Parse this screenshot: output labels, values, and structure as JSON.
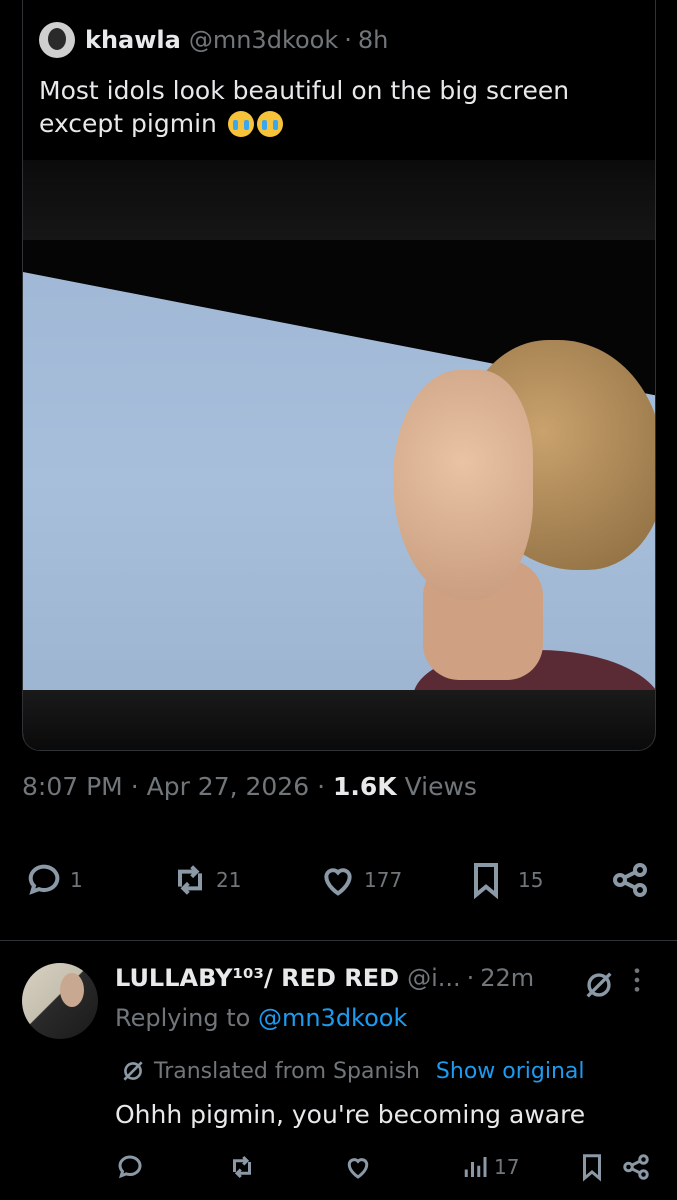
{
  "quoted": {
    "name": "khawla",
    "handle": "@mn3dkook",
    "separator": "·",
    "time": "8h",
    "text": "Most idols look beautiful on the big screen except pigmin",
    "emoji": "loudly-crying-face"
  },
  "meta": {
    "time": "8:07 PM",
    "date": "Apr 27, 2026",
    "views_count": "1.6K",
    "views_label": "Views"
  },
  "actions": {
    "replies": "1",
    "reposts": "21",
    "likes": "177",
    "bookmarks": "15"
  },
  "reply": {
    "name": "LULLABY¹⁰³/ RED RED",
    "handle": "@i...",
    "separator": "·",
    "time": "22m",
    "replying_prefix": "Replying to",
    "replying_to": "@mn3dkook",
    "translated_label": "Translated from Spanish",
    "show_original": "Show original",
    "text": "Ohhh pigmin, you're becoming aware",
    "views": "17"
  },
  "colors": {
    "background": "#000000",
    "text": "#e7e9ea",
    "muted": "#71767b",
    "link": "#1d9bf0",
    "border": "#2f3336"
  }
}
